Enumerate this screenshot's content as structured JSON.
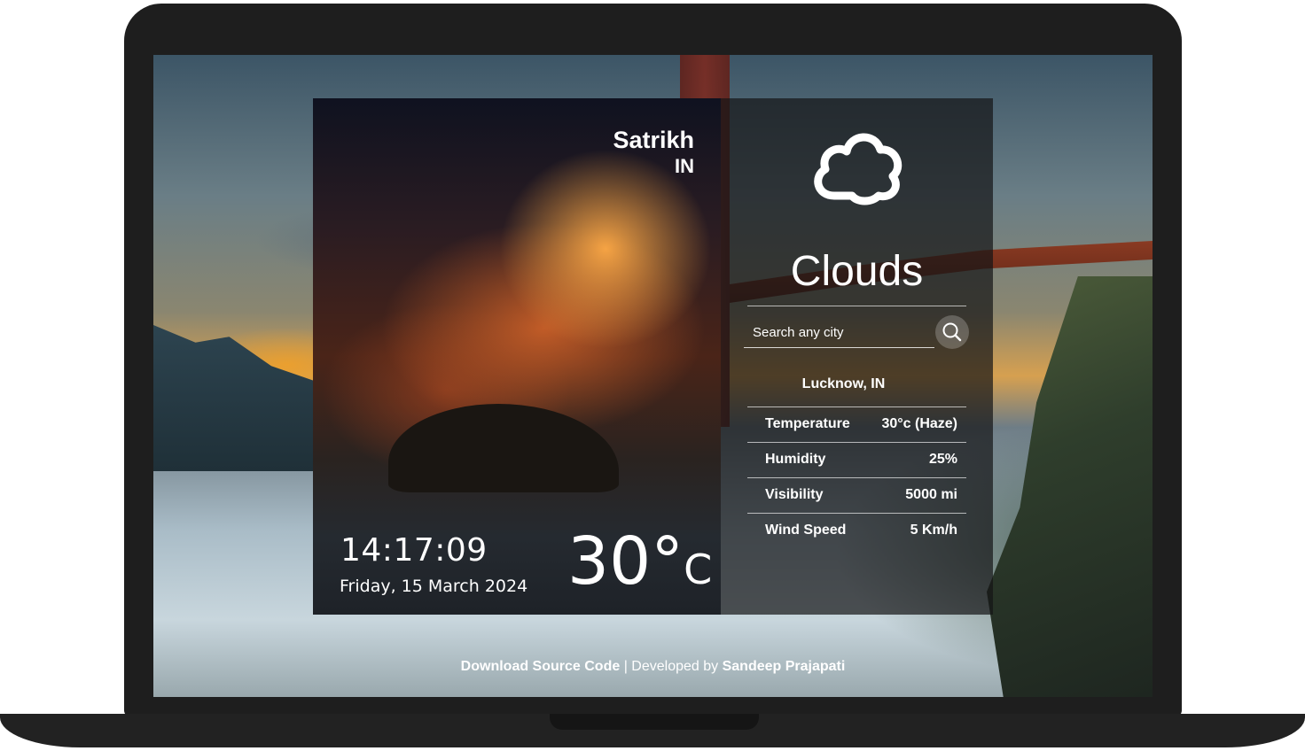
{
  "location": {
    "city": "Satrikh",
    "country": "IN"
  },
  "time": "14:17:09",
  "date": "Friday, 15 March 2024",
  "temperature": {
    "value": "30°",
    "unit": "C"
  },
  "condition": "Clouds",
  "search": {
    "placeholder": "Search any city",
    "value": ""
  },
  "result_city": "Lucknow, IN",
  "details": [
    {
      "label": "Temperature",
      "value": "30°c (Haze)"
    },
    {
      "label": "Humidity",
      "value": "25%"
    },
    {
      "label": "Visibility",
      "value": "5000 mi"
    },
    {
      "label": "Wind Speed",
      "value": "5 Km/h"
    }
  ],
  "footer": {
    "download_label": "Download Source Code",
    "separator": " | Developed by ",
    "author": "Sandeep Prajapati"
  },
  "icons": {
    "weather": "cloud-icon",
    "search": "search-icon"
  }
}
